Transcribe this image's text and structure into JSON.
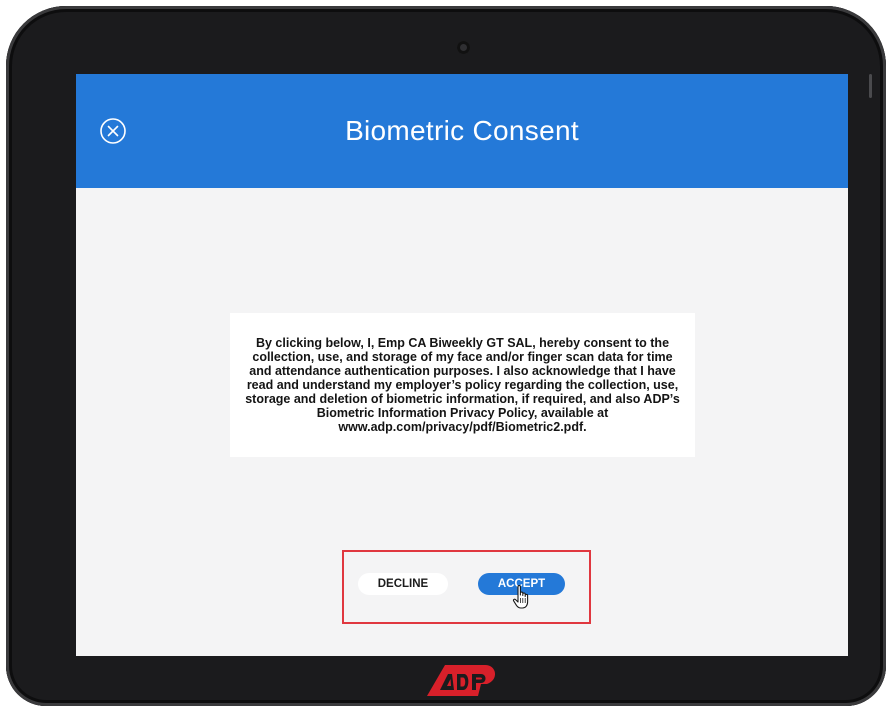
{
  "header": {
    "title": "Biometric Consent",
    "close_icon": "close-circle-icon"
  },
  "consent": {
    "text": "By clicking below, I, Emp CA Biweekly GT SAL, hereby consent to the collection, use, and storage of my face and/or finger scan data for time and attendance authentication purposes. I also acknowledge that I have read and understand my employer’s policy regarding the collection, use, storage and deletion of biometric information, if required, and also ADP’s Biometric Information Privacy Policy, available at www.adp.com/privacy/pdf/Biometric2.pdf."
  },
  "actions": {
    "decline_label": "DECLINE",
    "accept_label": "ACCEPT"
  },
  "footer": {
    "logo_text": "ADP",
    "logo_icon": "adp-logo"
  },
  "colors": {
    "header_blue": "#2479d8",
    "accept_blue": "#2479d8",
    "highlight_red": "#e0373f",
    "logo_red": "#d8202a",
    "screen_bg": "#f4f4f5",
    "device_frame": "#1b1b1d"
  },
  "cursor_icon": "hand-pointer-icon"
}
